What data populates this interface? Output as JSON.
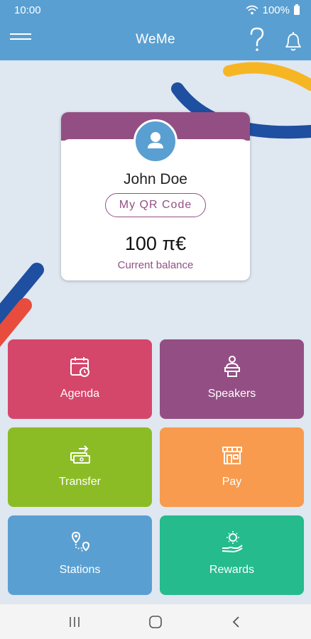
{
  "status_bar": {
    "time": "10:00",
    "battery": "100%"
  },
  "app_bar": {
    "title": "WeMe"
  },
  "profile": {
    "name": "John Doe",
    "qr_button_label": "My QR Code",
    "balance": "100 π€",
    "balance_label": "Current balance"
  },
  "tiles": [
    {
      "label": "Agenda",
      "icon": "calendar-icon",
      "color": "#d5466b"
    },
    {
      "label": "Speakers",
      "icon": "speaker-podium-icon",
      "color": "#934f84"
    },
    {
      "label": "Transfer",
      "icon": "money-transfer-icon",
      "color": "#8cbc25"
    },
    {
      "label": "Pay",
      "icon": "store-icon",
      "color": "#f89b4e"
    },
    {
      "label": "Stations",
      "icon": "map-route-icon",
      "color": "#5a9fd1"
    },
    {
      "label": "Rewards",
      "icon": "reward-hand-icon",
      "color": "#25bb8c"
    }
  ],
  "colors": {
    "primary": "#5a9fd1",
    "accent_purple": "#934f84",
    "decor_navy": "#1e4fa0",
    "decor_yellow": "#f6b624",
    "decor_red": "#e84c3d"
  }
}
